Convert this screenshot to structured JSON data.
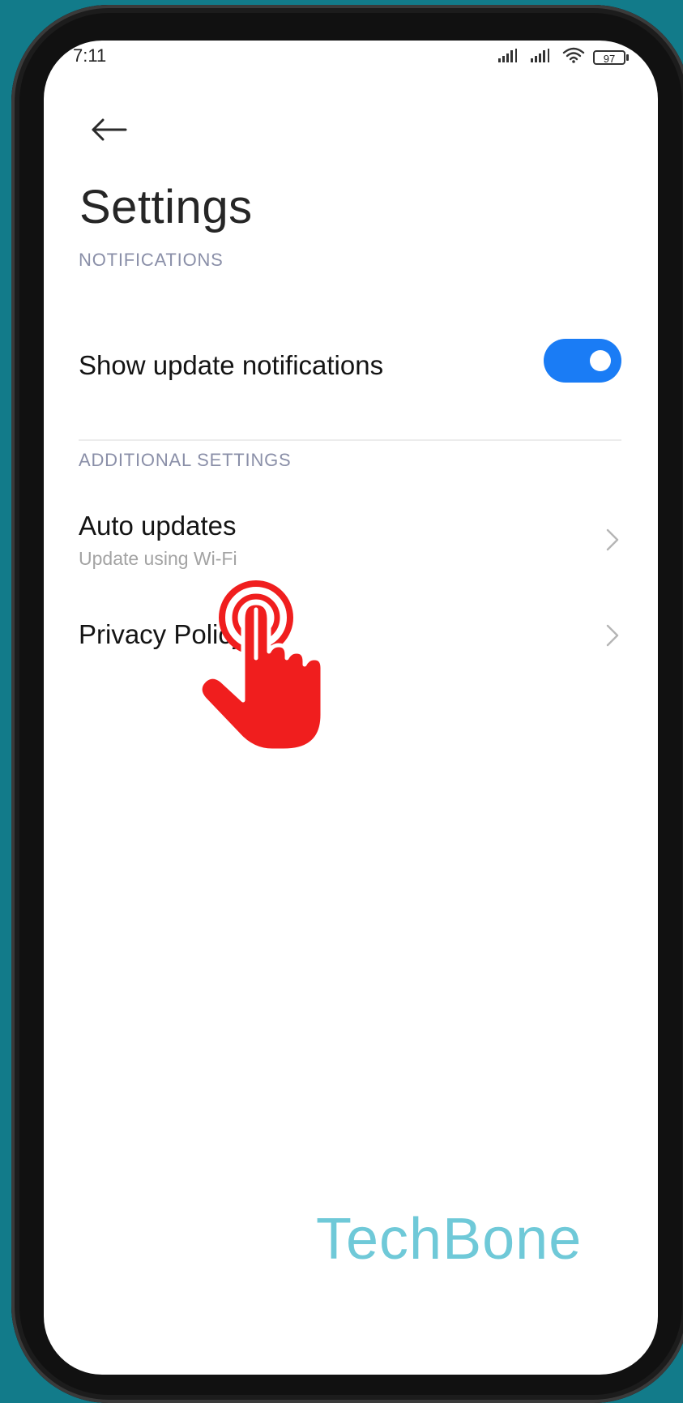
{
  "status_bar": {
    "time": "7:11",
    "battery_level": "97",
    "icons": [
      "signal-icon",
      "signal-icon",
      "wifi-icon",
      "battery-icon"
    ]
  },
  "header": {
    "back_icon": "arrow-left-icon",
    "title": "Settings"
  },
  "sections": {
    "notifications": {
      "header": "NOTIFICATIONS",
      "show_update_notifications": {
        "label": "Show update notifications",
        "enabled": true
      }
    },
    "additional": {
      "header": "ADDITIONAL SETTINGS",
      "auto_updates": {
        "label": "Auto updates",
        "subtitle": "Update using Wi-Fi"
      },
      "privacy_policy": {
        "label": "Privacy Policy"
      }
    }
  },
  "overlay": {
    "tap_icon": "tap-hand-icon",
    "watermark": "TechBone"
  },
  "colors": {
    "accent": "#1a7cf5",
    "background": "#127b8a",
    "tap_indicator": "#f01e1e",
    "watermark": "#3fb8cc"
  }
}
